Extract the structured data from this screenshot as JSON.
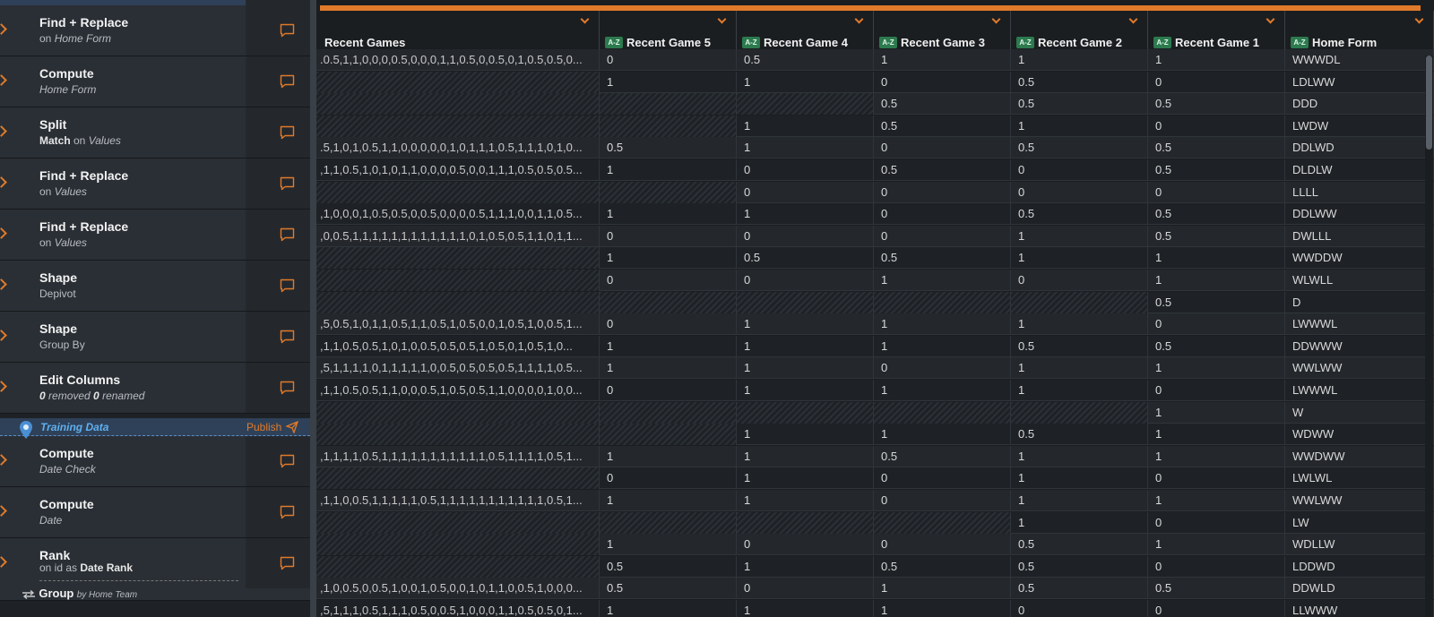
{
  "steps": [
    {
      "title": "Find + Replace",
      "sub": [
        {
          "t": "on ",
          "s": "n"
        },
        {
          "t": "Home Form",
          "s": "i"
        }
      ]
    },
    {
      "title": "Compute",
      "sub": [
        {
          "t": "Home Form",
          "s": "i"
        }
      ]
    },
    {
      "title": "Split",
      "sub": [
        {
          "t": "Match",
          "s": "b"
        },
        {
          "t": " on ",
          "s": "n"
        },
        {
          "t": "Values",
          "s": "i"
        }
      ]
    },
    {
      "title": "Find + Replace",
      "sub": [
        {
          "t": "on ",
          "s": "n"
        },
        {
          "t": "Values",
          "s": "i"
        }
      ]
    },
    {
      "title": "Find + Replace",
      "sub": [
        {
          "t": "on ",
          "s": "n"
        },
        {
          "t": "Values",
          "s": "i"
        }
      ]
    },
    {
      "title": "Shape",
      "sub": [
        {
          "t": "Depivot",
          "s": "n"
        }
      ]
    },
    {
      "title": "Shape",
      "sub": [
        {
          "t": "Group By",
          "s": "n"
        }
      ]
    },
    {
      "title": "Edit Columns",
      "sub": [
        {
          "t": "0",
          "s": "bi"
        },
        {
          "t": " removed ",
          "s": "i"
        },
        {
          "t": "0",
          "s": "bi"
        },
        {
          "t": " renamed",
          "s": "i"
        }
      ]
    },
    {
      "title": "Compute",
      "sub": [
        {
          "t": "Date Check",
          "s": "i"
        }
      ]
    },
    {
      "title": "Compute",
      "sub": [
        {
          "t": "Date",
          "s": "i"
        }
      ]
    },
    {
      "title": "Rank",
      "sub": [
        {
          "t": "on id as ",
          "s": "n"
        },
        {
          "t": "Date Rank",
          "s": "b"
        }
      ]
    }
  ],
  "divider": {
    "label": "Training Data",
    "publish": "Publish"
  },
  "group_row": {
    "title": "Group",
    "sub": "by Home Team"
  },
  "grid": {
    "type_badge": "A-Z",
    "columns": [
      "Recent Games",
      "Recent Game 5",
      "Recent Game 4",
      "Recent Game 3",
      "Recent Game 2",
      "Recent Game 1",
      "Home Form"
    ],
    "rows": [
      [
        ".0.5,1,1,0,0,0,0.5,0,0,0,1,1,0.5,0,0.5,0,1,0.5,0.5,0...",
        "0",
        "0.5",
        "1",
        "1",
        "1",
        "WWWDL"
      ],
      [
        "",
        "1",
        "1",
        "0",
        "0.5",
        "0",
        "LDLWW"
      ],
      [
        "",
        "",
        "",
        "0.5",
        "0.5",
        "0.5",
        "DDD"
      ],
      [
        "",
        "",
        "1",
        "0.5",
        "1",
        "0",
        "LWDW"
      ],
      [
        ".5,1,0,1,0.5,1,1,0,0,0,0,0,1,0,1,1,1,0.5,1,1,1,0,1,0...",
        "0.5",
        "1",
        "0",
        "0.5",
        "0.5",
        "DDLWD"
      ],
      [
        ",1,1,0.5,1,0,1,0,1,1,0,0,0,0.5,0,0,1,1,1,0.5,0.5,0.5...",
        "1",
        "0",
        "0.5",
        "0",
        "0.5",
        "DLDLW"
      ],
      [
        "",
        "",
        "0",
        "0",
        "0",
        "0",
        "LLLL"
      ],
      [
        ",1,0,0,0,1,0.5,0.5,0,0.5,0,0,0,0.5,1,1,1,0,0,1,1,0.5...",
        "1",
        "1",
        "0",
        "0.5",
        "0.5",
        "DDLWW"
      ],
      [
        ",0,0.5,1,1,1,1,1,1,1,1,1,1,1,1,0,1,0.5,0.5,1,1,0,1,1...",
        "0",
        "0",
        "0",
        "1",
        "0.5",
        "DWLLL"
      ],
      [
        "",
        "1",
        "0.5",
        "0.5",
        "1",
        "1",
        "WWDDW"
      ],
      [
        "",
        "0",
        "0",
        "1",
        "0",
        "1",
        "WLWLL"
      ],
      [
        "",
        "",
        "",
        "",
        "",
        "0.5",
        "D"
      ],
      [
        ",5,0.5,1,0,1,1,0.5,1,1,0.5,1,0.5,0,0,1,0.5,1,0,0.5,1...",
        "0",
        "1",
        "1",
        "1",
        "0",
        "LWWWL"
      ],
      [
        ",1,1,0.5,0.5,1,0,1,0,0.5,0.5,0.5,1,0.5,0,1,0.5,1,0...",
        "1",
        "1",
        "1",
        "0.5",
        "0.5",
        "DDWWW"
      ],
      [
        ",5,1,1,1,1,0,1,1,1,1,1,0,0.5,0.5,0.5,0.5,1,1,1,1,0.5...",
        "1",
        "1",
        "0",
        "1",
        "1",
        "WWLWW"
      ],
      [
        ",1,1,0.5,0.5,1,1,0,0,0.5,1,0.5,0.5,1,1,0,0,0,0,1,0,0...",
        "0",
        "1",
        "1",
        "1",
        "0",
        "LWWWL"
      ],
      [
        "",
        "",
        "",
        "",
        "",
        "1",
        "W"
      ],
      [
        "",
        "",
        "1",
        "1",
        "0.5",
        "1",
        "WDWW"
      ],
      [
        ",1,1,1,1,0.5,1,1,1,1,1,1,1,1,1,1,1,0.5,1,1,1,1,0.5,1...",
        "1",
        "1",
        "0.5",
        "1",
        "1",
        "WWDWW"
      ],
      [
        "",
        "0",
        "1",
        "0",
        "1",
        "0",
        "LWLWL"
      ],
      [
        ",1,1,0,0.5,1,1,1,1,1,0.5,1,1,1,1,1,1,1,1,1,1,1,0.5,1...",
        "1",
        "1",
        "0",
        "1",
        "1",
        "WWLWW"
      ],
      [
        "",
        "",
        "",
        "",
        "1",
        "0",
        "LW"
      ],
      [
        "",
        "1",
        "0",
        "0",
        "0.5",
        "1",
        "WDLLW"
      ],
      [
        "",
        "0.5",
        "1",
        "0.5",
        "0.5",
        "0",
        "LDDWD"
      ],
      [
        ",1,0,0.5,0,0.5,1,0,0,1,0.5,0,0,1,0,1,1,0,0.5,1,0,0,0...",
        "0.5",
        "0",
        "1",
        "0.5",
        "0.5",
        "DDWLD"
      ],
      [
        ",5,1,1,1,0.5,1,1,1,0.5,0,0.5,1,0,0,0,1,1,0.5,0.5,0,1...",
        "1",
        "1",
        "1",
        "0",
        "0",
        "LLWWW"
      ]
    ]
  },
  "colors": {
    "accent": "#e07a2a",
    "badge": "#2c7a4e",
    "training": "#5fb0f0"
  }
}
